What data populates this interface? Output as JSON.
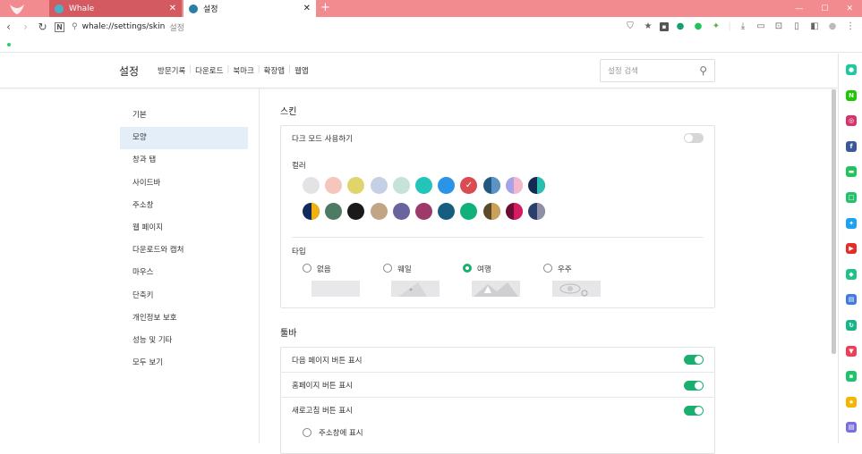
{
  "tabs": [
    {
      "title": "Whale",
      "favicon_color": "#4ab1c9",
      "close": "✕"
    },
    {
      "title": "설정",
      "favicon_color": "#2a7fa8",
      "close": "✕"
    }
  ],
  "new_tab": "+",
  "window_controls": {
    "minimize": "—",
    "maximize": "☐",
    "close": "✕"
  },
  "address": {
    "url": "whale://settings/skin",
    "page_name": "설정"
  },
  "settings_header": {
    "title": "설정",
    "nav": [
      "방문기록",
      "다운로드",
      "북마크",
      "확장앱",
      "웹앱"
    ],
    "search_placeholder": "설정 검색"
  },
  "menu": [
    "기본",
    "모양",
    "창과 탭",
    "사이드바",
    "주소창",
    "웹 페이지",
    "다운로드와 캡처",
    "마우스",
    "단축키",
    "개인정보 보호",
    "성능 및 기타",
    "모두 보기"
  ],
  "menu_active": "모양",
  "skin": {
    "section_title": "스킨",
    "dark_mode_label": "다크 모드 사용하기",
    "dark_mode_on": false,
    "color_label": "컬러",
    "colors_row1": [
      {
        "c": "#e3e3e6"
      },
      {
        "c": "#f5c6bd"
      },
      {
        "c": "#e0d46c"
      },
      {
        "c": "#c6d0e4"
      },
      {
        "c": "#c5e3d8"
      },
      {
        "c": "#22c5b8"
      },
      {
        "c": "#2a94e8"
      },
      {
        "c": "#d94c52",
        "selected": true
      },
      {
        "c": "#245880",
        "c2": "#5b93c7"
      },
      {
        "c": "#a8a3e8",
        "c2": "#f4b8cb"
      },
      {
        "c": "#142a52",
        "c2": "#26bfb0"
      }
    ],
    "colors_row2": [
      {
        "c": "#122a5c",
        "c2": "#f2b10c"
      },
      {
        "c": "#4d7a63"
      },
      {
        "c": "#1a1a1a"
      },
      {
        "c": "#c2a584"
      },
      {
        "c": "#6a649c"
      },
      {
        "c": "#9e3a6a"
      },
      {
        "c": "#155e80"
      },
      {
        "c": "#12b07a"
      },
      {
        "c": "#5a4a2a",
        "c2": "#c9a15a"
      },
      {
        "c": "#6a0e38",
        "c2": "#d61c60"
      },
      {
        "c": "#2a3f6c",
        "c2": "#8f8fa8"
      }
    ],
    "check_mark": "✓",
    "type_label": "타입",
    "types": [
      {
        "label": "없음",
        "selected": false
      },
      {
        "label": "웨일",
        "selected": false
      },
      {
        "label": "여행",
        "selected": true
      },
      {
        "label": "우주",
        "selected": false
      }
    ]
  },
  "toolbar": {
    "section_title": "툴바",
    "rows": [
      {
        "label": "다음 페이지 버튼 표시",
        "on": true
      },
      {
        "label": "홈페이지 버튼 표시",
        "on": true
      },
      {
        "label": "새로고침 버튼 표시",
        "on": true
      }
    ],
    "sub_option": "주소창에 표시"
  },
  "sidebar_apps": [
    {
      "name": "whale-space",
      "color": "#1dc9a0",
      "glyph": "●"
    },
    {
      "name": "naver",
      "color": "#1ec800",
      "glyph": "N"
    },
    {
      "name": "instagram",
      "color": "#d6336c",
      "glyph": "◎"
    },
    {
      "name": "facebook",
      "color": "#3b5998",
      "glyph": "f"
    },
    {
      "name": "line",
      "color": "#21c35b",
      "glyph": "▬"
    },
    {
      "name": "band",
      "color": "#24c16a",
      "glyph": "□"
    },
    {
      "name": "twitter",
      "color": "#1da1f2",
      "glyph": "✦"
    },
    {
      "name": "youtube",
      "color": "#e52d27",
      "glyph": "▶"
    },
    {
      "name": "notification",
      "color": "#1ec487",
      "glyph": "◆"
    },
    {
      "name": "memo",
      "color": "#3f7be0",
      "glyph": "▤"
    },
    {
      "name": "translate",
      "color": "#19b58a",
      "glyph": "↻"
    },
    {
      "name": "pocket",
      "color": "#ef3f56",
      "glyph": "▼"
    },
    {
      "name": "calculator",
      "color": "#1cc56b",
      "glyph": "▪"
    },
    {
      "name": "favorites",
      "color": "#f4b400",
      "glyph": "★"
    },
    {
      "name": "more",
      "color": "#7a6fe0",
      "glyph": "▤"
    }
  ]
}
